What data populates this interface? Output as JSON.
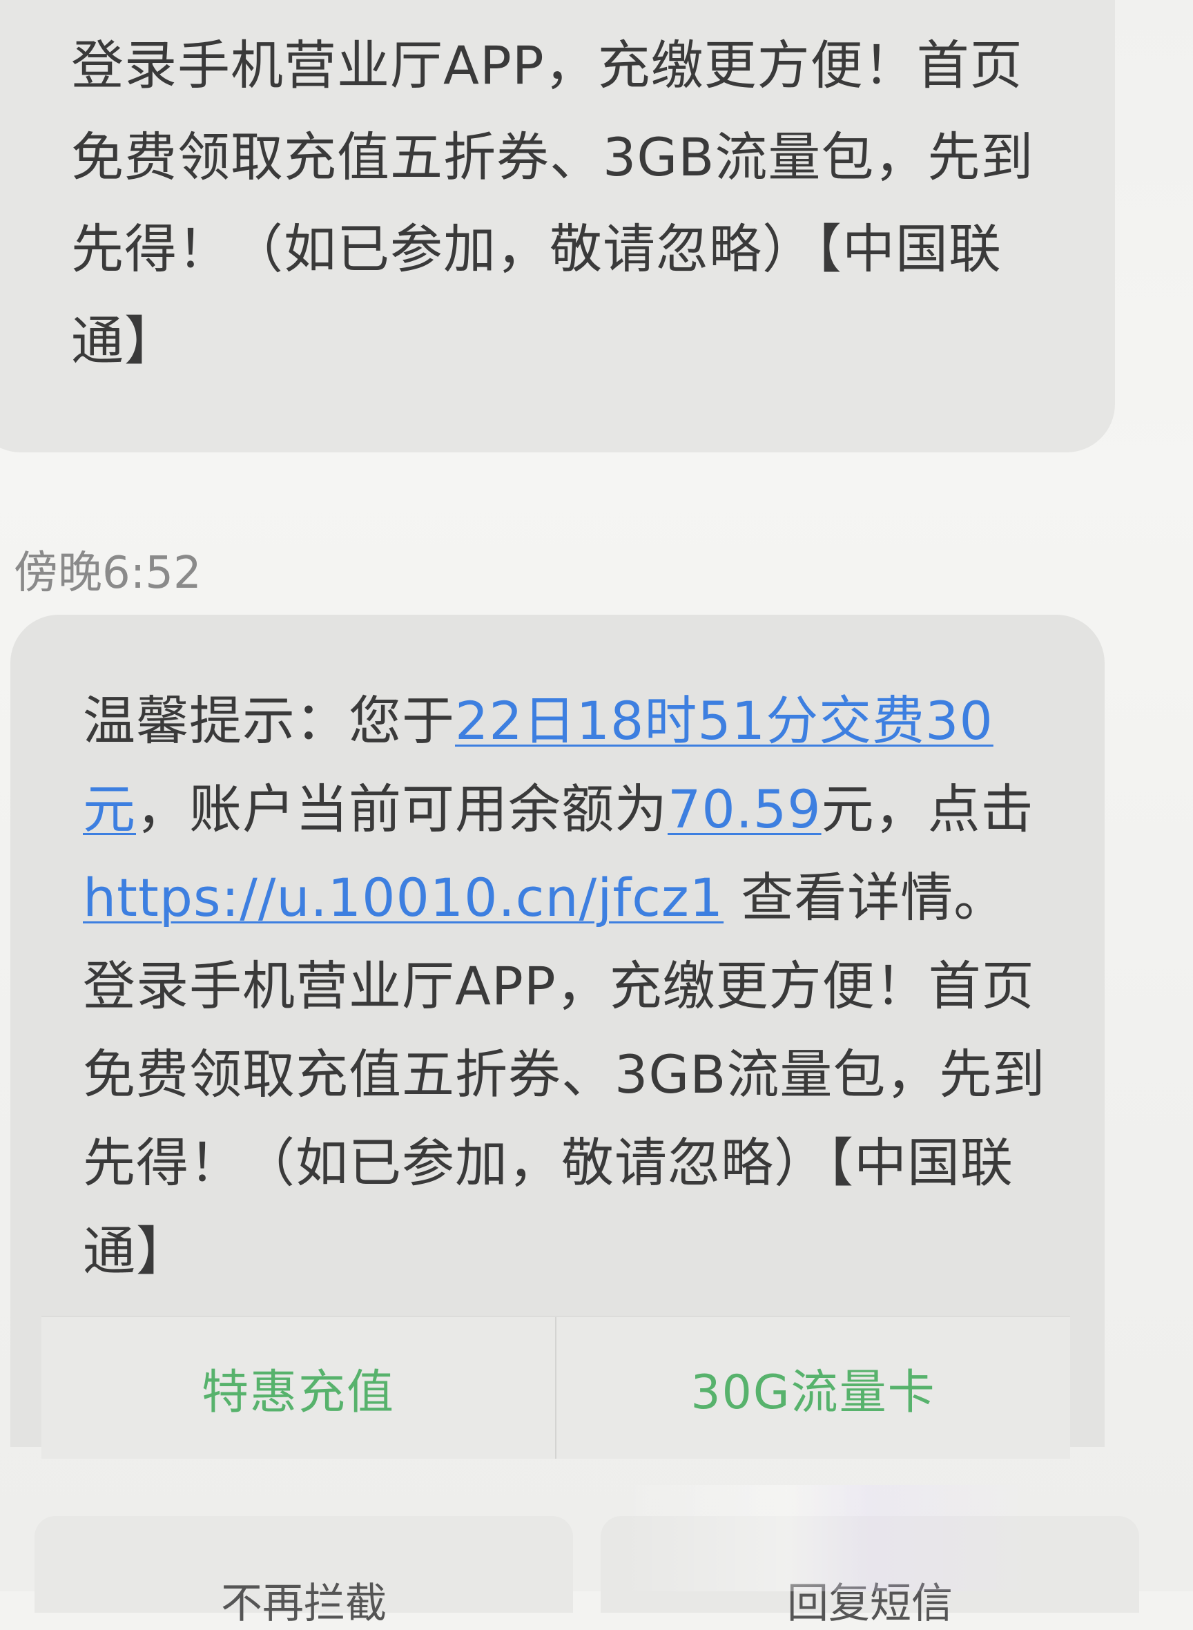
{
  "previous_message": {
    "text": "登录手机营业厅APP，充缴更方便！首页免费领取充值五折券、3GB流量包，先到先得！（如已参加，敬请忽略）【中国联通】"
  },
  "timestamp": "傍晚6:52",
  "message": {
    "prefix": "温馨提示：您于",
    "time_link": "22日18时51分交费30元",
    "middle": "，账户当前可用余额为",
    "balance_link": "70.59",
    "suffix": "元，点击 ",
    "url_link": "https://u.10010.cn/jfcz1",
    "after_url": " 查看详情。",
    "promo": "登录手机营业厅APP，充缴更方便！首页免费领取充值五折券、3GB流量包，先到先得！（如已参加，敬请忽略）【中国联通】"
  },
  "actions": {
    "left_label": "特惠充值",
    "right_label": "30G流量卡"
  },
  "bottom": {
    "left_label": "不再拦截",
    "right_label": "回复短信"
  },
  "colors": {
    "link": "#3d7fe0",
    "action_text": "#57b26c",
    "bubble": "#e3e3e1"
  }
}
